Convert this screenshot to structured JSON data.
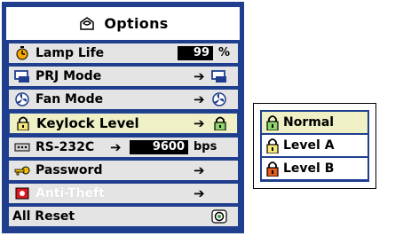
{
  "menu": {
    "title": "Options",
    "title_icon": "options-icon",
    "items": [
      {
        "label": "Lamp Life",
        "icon": "lamp-life-icon",
        "value": "99",
        "unit": "%"
      },
      {
        "label": "PRJ Mode",
        "icon": "prj-mode-icon"
      },
      {
        "label": "Fan Mode",
        "icon": "fan-mode-icon"
      },
      {
        "label": "Keylock Level",
        "icon": "lock-icon",
        "selected": true
      },
      {
        "label": "RS-232C",
        "icon": "rs232c-icon",
        "value": "9600",
        "unit": "bps"
      },
      {
        "label": "Password",
        "icon": "key-icon"
      },
      {
        "label": "Anti-Theft",
        "icon": "anti-theft-icon",
        "disabled": true
      },
      {
        "label": "All Reset",
        "icon": "reset-icon"
      }
    ],
    "arrow_glyph": "➔"
  },
  "keylock_submenu": {
    "options": [
      {
        "label": "Normal",
        "icon": "lock-icon-green",
        "selected": true
      },
      {
        "label": "Level A",
        "icon": "lock-icon-yellow"
      },
      {
        "label": "Level B",
        "icon": "lock-icon-red"
      }
    ]
  },
  "colors": {
    "panel_blue": "#1f3f8e",
    "row_gray": "#e4e4e4",
    "highlight": "#f0f0c6"
  }
}
